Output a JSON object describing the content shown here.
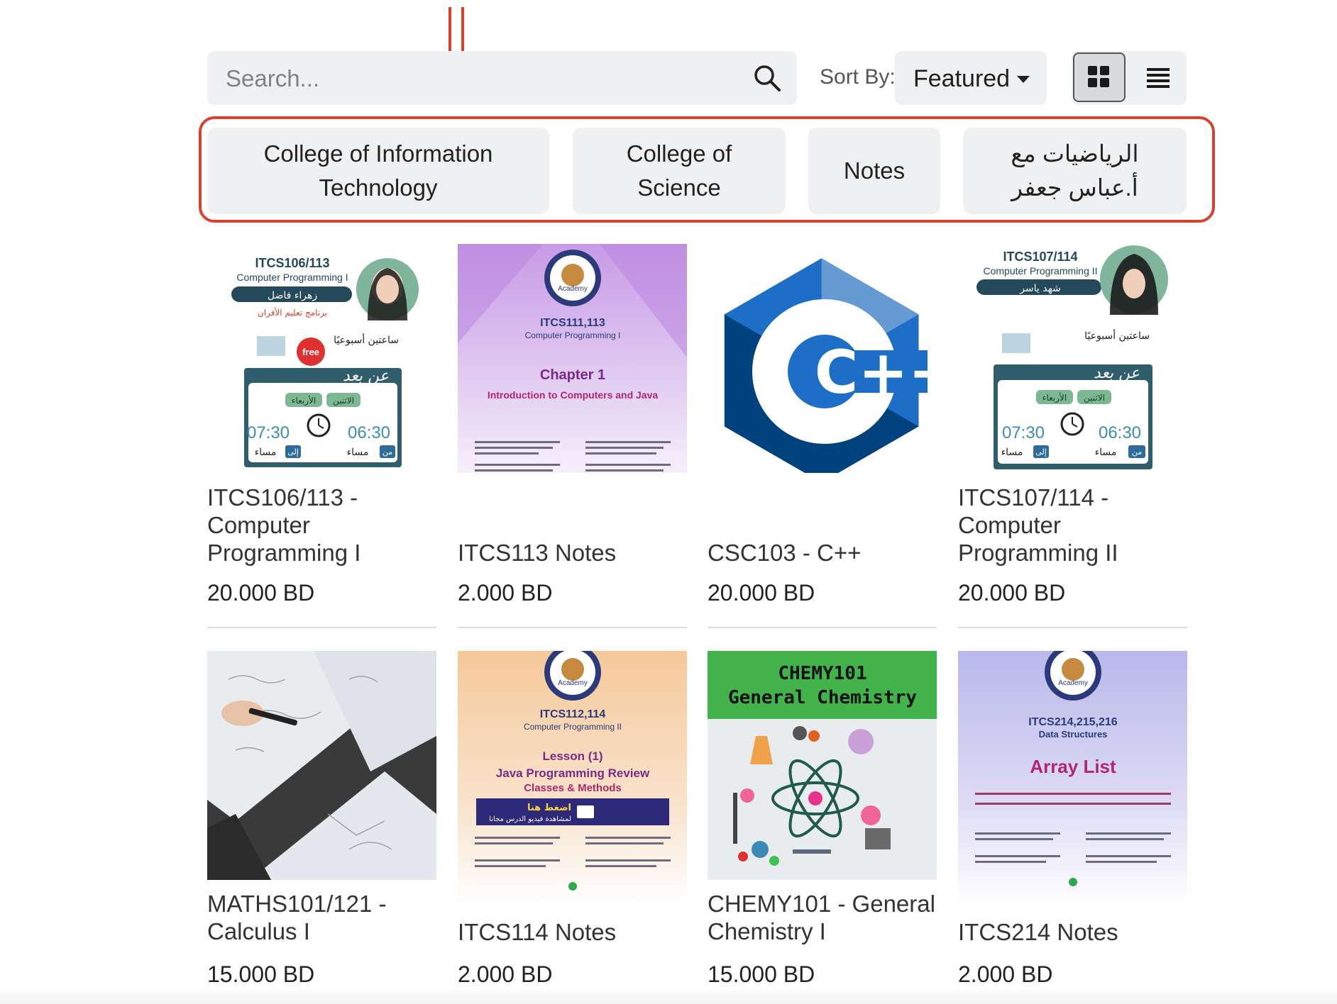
{
  "search": {
    "placeholder": "Search...",
    "icon": "search-icon"
  },
  "sort": {
    "label": "Sort By:",
    "selected": "Featured"
  },
  "view_toggle": {
    "grid_icon": "grid-view-icon",
    "list_icon": "list-view-icon",
    "active": "grid"
  },
  "annotation_color": "#d9412f",
  "categories": [
    {
      "label": "College of Information\nTechnology"
    },
    {
      "label": "College of\nScience"
    },
    {
      "label": "Notes"
    },
    {
      "label": "الرياضيات مع\nأ.عباس جعفر"
    }
  ],
  "products": [
    {
      "title": "ITCS106/113 -\nComputer\nProgramming I",
      "price": "20.000 BD",
      "poster": {
        "code": "ITCS106/113",
        "course": "Computer Programming I",
        "instructor": "زهراء فاضل",
        "program": "برنامج تعليم الأقران",
        "weekly": "ساعتين أسبوعيًا",
        "remote": "عن بعد",
        "day1": "الاثنين",
        "day2": "الأربعاء",
        "time_from": "06:30",
        "time_to": "07:30",
        "from": "من",
        "to": "إلى",
        "pm": "مساء",
        "badge": "free"
      }
    },
    {
      "title": "ITCS113 Notes",
      "price": "2.000 BD",
      "poster": {
        "brand": "Academy",
        "code": "ITCS111,113",
        "course": "Computer Programming I",
        "heading": "Chapter 1",
        "subheading": "Introduction to Computers and Java"
      }
    },
    {
      "title": "CSC103 - C++",
      "price": "20.000 BD",
      "poster": {
        "logo": "C++"
      }
    },
    {
      "title": "ITCS107/114 -\nComputer\nProgramming II",
      "price": "20.000 BD",
      "poster": {
        "code": "ITCS107/114",
        "course": "Computer Programming II",
        "instructor": "شهد ياسر",
        "weekly": "ساعتين أسبوعيًا",
        "remote": "عن بعد",
        "day1": "الاثنين",
        "day2": "الأربعاء",
        "time_from": "06:30",
        "time_to": "07:30",
        "from": "من",
        "to": "إلى",
        "pm": "مساء"
      }
    },
    {
      "title": "MATHS101/121 -\nCalculus I",
      "price": "15.000 BD",
      "poster": {}
    },
    {
      "title": "ITCS114 Notes",
      "price": "2.000 BD",
      "poster": {
        "brand": "Academy",
        "code": "ITCS112,114",
        "course": "Computer Programming II",
        "heading": "Lesson (1)",
        "subheading": "Java Programming Review",
        "subheading2": "Classes & Methods",
        "video_line1": "اضغط هنا",
        "video_line2": "لمشاهدة فيديو الدرس مجانا"
      }
    },
    {
      "title": "CHEMY101 - General\nChemistry I",
      "price": "15.000 BD",
      "poster": {
        "line1": "CHEMY101",
        "line2": "General Chemistry"
      }
    },
    {
      "title": "ITCS214 Notes",
      "price": "2.000 BD",
      "poster": {
        "brand": "Academy",
        "code": "ITCS214,215,216",
        "course": "Data Structures",
        "heading": "Array List"
      }
    }
  ]
}
